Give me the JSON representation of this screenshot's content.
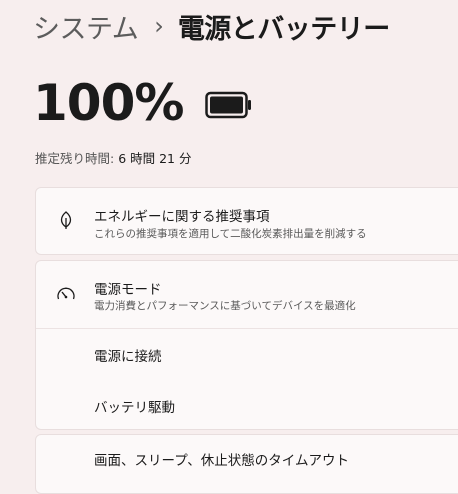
{
  "breadcrumb": {
    "parent": "システム",
    "separator": "›",
    "current": "電源とバッテリー"
  },
  "battery": {
    "percent_text": "100%",
    "level": 1.0,
    "icon": "battery-full-icon",
    "estimate_label": "推定残り時間:",
    "estimate_value": "6 時間 21 分"
  },
  "energy_recommendations": {
    "icon": "leaf-icon",
    "title": "エネルギーに関する推奨事項",
    "subtitle": "これらの推奨事項を適用して二酸化炭素排出量を削減する"
  },
  "power_mode": {
    "icon": "gauge-icon",
    "title": "電源モード",
    "subtitle": "電力消費とパフォーマンスに基づいてデバイスを最適化",
    "options": [
      {
        "label": "電源に接続"
      },
      {
        "label": "バッテリ駆動"
      }
    ]
  },
  "screen_sleep": {
    "title": "画面、スリープ、休止状態のタイムアウト"
  },
  "colors": {
    "background": "#f7eeee",
    "card": "#fcf9f9",
    "text_primary": "#1b1b1b",
    "text_secondary": "#5c5c5c"
  }
}
